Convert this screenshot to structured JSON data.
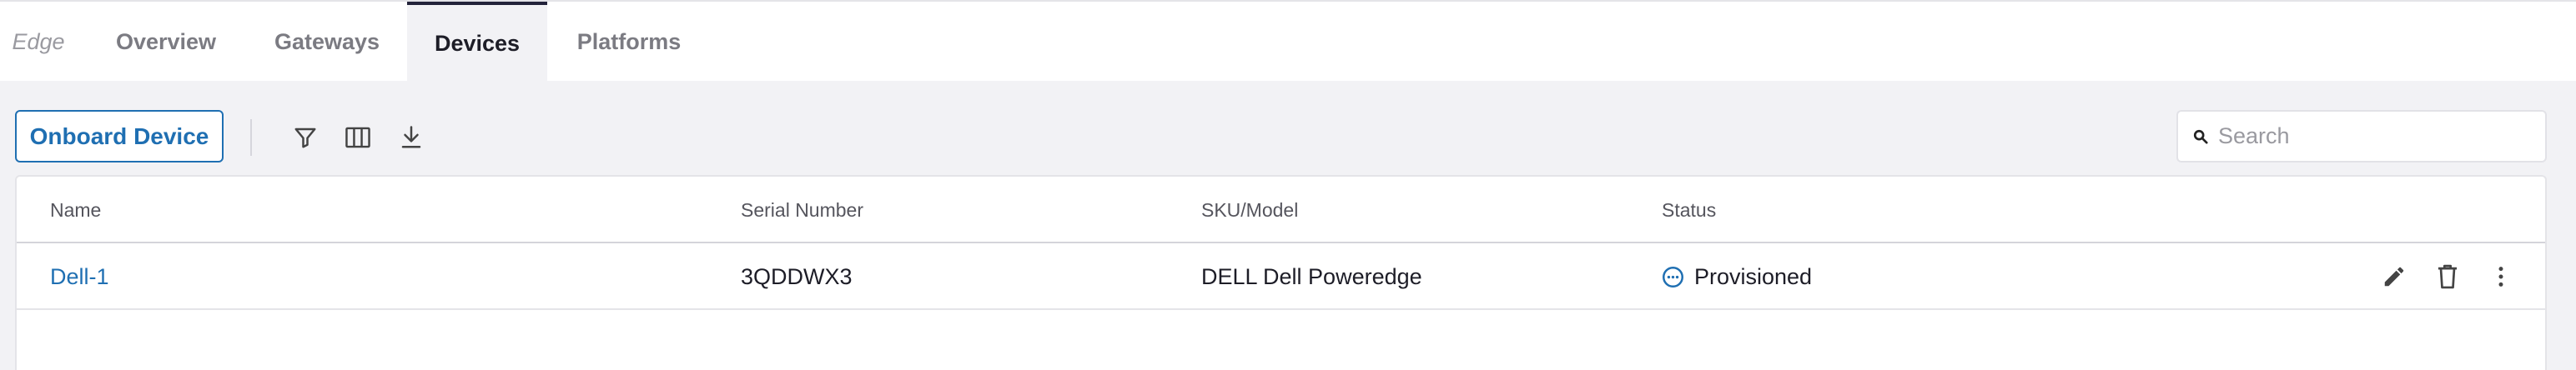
{
  "nav": {
    "breadcrumb": "Edge",
    "tabs": [
      {
        "label": "Overview",
        "active": false
      },
      {
        "label": "Gateways",
        "active": false
      },
      {
        "label": "Devices",
        "active": true
      },
      {
        "label": "Platforms",
        "active": false
      }
    ]
  },
  "toolbar": {
    "onboard_label": "Onboard Device",
    "icons": [
      "filter-icon",
      "columns-icon",
      "download-icon"
    ],
    "search_placeholder": "Search"
  },
  "table": {
    "columns": [
      "Name",
      "Serial Number",
      "SKU/Model",
      "Status"
    ],
    "rows": [
      {
        "name": "Dell-1",
        "serial": "3QDDWX3",
        "model": "DELL Dell Poweredge",
        "status": "Provisioned"
      }
    ],
    "row_actions": [
      "edit-icon",
      "delete-icon",
      "more-icon"
    ]
  },
  "colors": {
    "accent": "#1f6fb2",
    "active_tab_indicator": "#23233a",
    "page_background": "#f2f2f5"
  }
}
